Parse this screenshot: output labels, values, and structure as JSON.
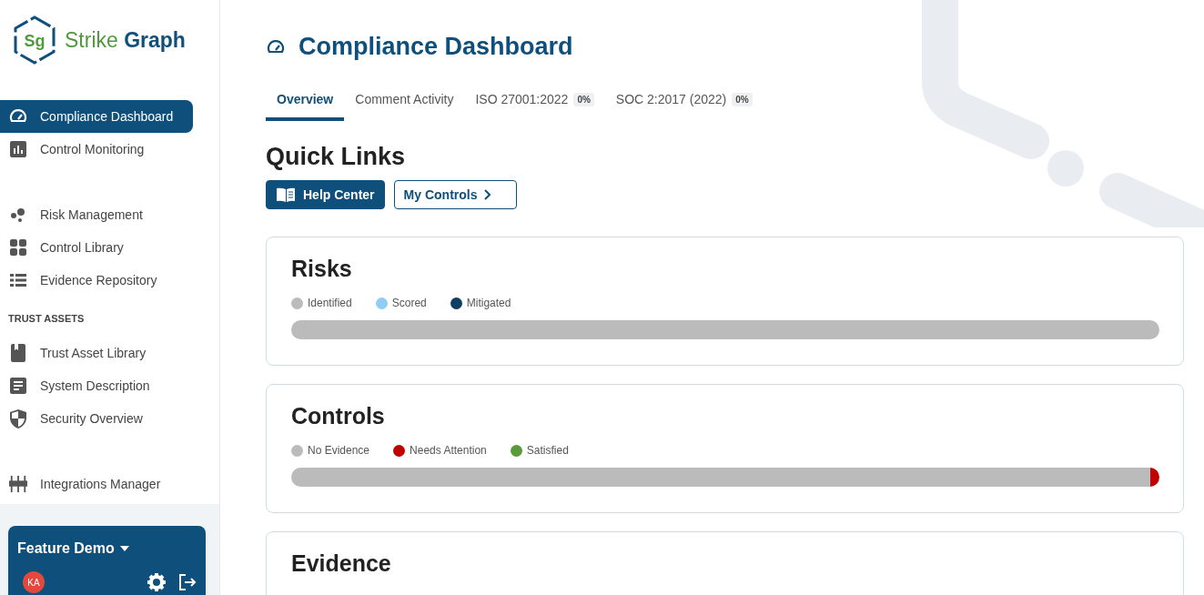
{
  "logo": {
    "mark": "Sg",
    "word_1": "Strike",
    "word_2": "Graph"
  },
  "sidebar": {
    "groups": [
      {
        "items": [
          {
            "label": "Compliance Dashboard",
            "selected": true
          },
          {
            "label": "Control Monitoring",
            "selected": false
          }
        ]
      },
      {
        "items": [
          {
            "label": "Risk Management",
            "selected": false
          },
          {
            "label": "Control Library",
            "selected": false
          },
          {
            "label": "Evidence Repository",
            "selected": false
          }
        ]
      },
      {
        "heading": "TRUST ASSETS",
        "items": [
          {
            "label": "Trust Asset Library",
            "selected": false
          },
          {
            "label": "System Description",
            "selected": false
          },
          {
            "label": "Security Overview",
            "selected": false
          }
        ]
      },
      {
        "items": [
          {
            "label": "Integrations Manager",
            "selected": false
          }
        ]
      }
    ],
    "workspace": {
      "name": "Feature Demo",
      "avatar": "KA"
    }
  },
  "page": {
    "title": "Compliance Dashboard",
    "tabs": [
      {
        "label": "Overview",
        "selected": true
      },
      {
        "label": "Comment Activity",
        "selected": false
      },
      {
        "label": "ISO 27001:2022",
        "badge": "0%",
        "selected": false
      },
      {
        "label": "SOC 2:2017 (2022)",
        "badge": "0%",
        "selected": false
      }
    ],
    "quick_links": {
      "title": "Quick Links",
      "buttons": [
        {
          "label": "Help Center",
          "kind": "primary"
        },
        {
          "label": "My Controls",
          "kind": "outline"
        }
      ]
    },
    "cards": [
      {
        "title": "Risks",
        "segments": [
          {
            "label": "Identified",
            "color": "#bbbbbb",
            "level": 1
          },
          {
            "label": "Scored",
            "color": "#90cdf4",
            "level": 0
          },
          {
            "label": "Mitigated",
            "color": "#0e3f63",
            "level": 0
          }
        ]
      },
      {
        "title": "Controls",
        "segments": [
          {
            "label": "No Evidence",
            "color": "#bbbbbb",
            "level": 0.99
          },
          {
            "label": "Needs Attention",
            "color": "#c00000",
            "level": 0.01
          },
          {
            "label": "Satisfied",
            "color": "#5a9a3a",
            "level": 0
          }
        ]
      },
      {
        "title": "Evidence"
      }
    ]
  }
}
